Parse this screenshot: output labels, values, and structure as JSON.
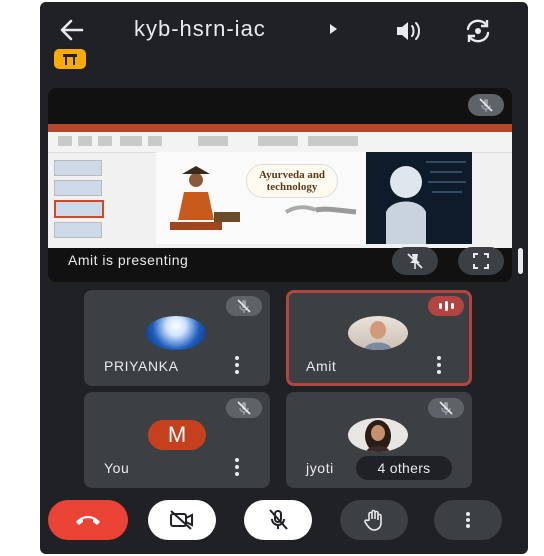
{
  "meeting": {
    "code": "kyb-hsrn-iac"
  },
  "presentation": {
    "label": "Amit is presenting",
    "slide_title": "Ayurveda and technology"
  },
  "participants": [
    {
      "name": "PRIYANKA",
      "muted": true,
      "speaking": false,
      "avatar": "photo"
    },
    {
      "name": "Amit",
      "muted": false,
      "speaking": true,
      "avatar": "photo"
    },
    {
      "name": "You",
      "muted": true,
      "speaking": false,
      "avatar": "M"
    },
    {
      "name": "jyoti",
      "muted": true,
      "speaking": false,
      "avatar": "photo"
    }
  ],
  "others_chip": "4 others",
  "colors": {
    "background": "#202124",
    "tile": "#3c4043",
    "end_call": "#ea4335",
    "speaking": "#b3443f",
    "badge": "#f9ab00"
  },
  "controls": [
    "end-call",
    "camera-off",
    "mic-off",
    "raise-hand",
    "more-options"
  ]
}
